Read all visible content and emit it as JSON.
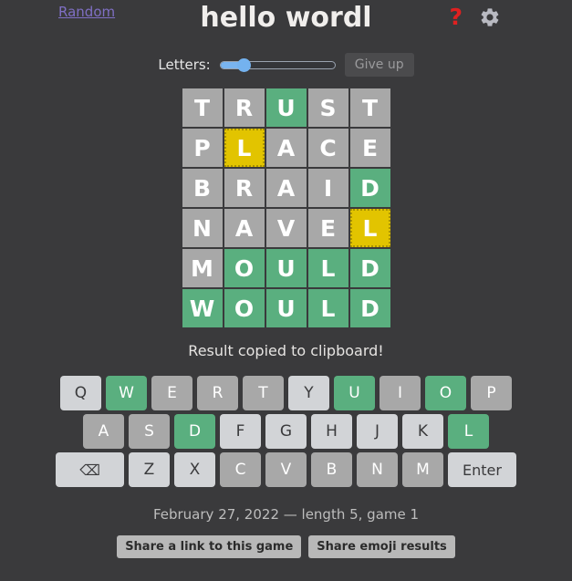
{
  "header": {
    "random_link": "Random",
    "title": "hello wordl",
    "help_icon": "?",
    "gear_icon": "gear-icon"
  },
  "controls": {
    "letters_label": "Letters:",
    "slider_value": "5",
    "slider_min": "4",
    "slider_max": "11",
    "give_up_label": "Give up"
  },
  "board": {
    "rows": [
      {
        "letters": [
          "T",
          "R",
          "U",
          "S",
          "T"
        ],
        "states": [
          "absent",
          "absent",
          "correct",
          "absent",
          "absent"
        ]
      },
      {
        "letters": [
          "P",
          "L",
          "A",
          "C",
          "E"
        ],
        "states": [
          "absent",
          "elsewhere",
          "absent",
          "absent",
          "absent"
        ]
      },
      {
        "letters": [
          "B",
          "R",
          "A",
          "I",
          "D"
        ],
        "states": [
          "absent",
          "absent",
          "absent",
          "absent",
          "correct"
        ]
      },
      {
        "letters": [
          "N",
          "A",
          "V",
          "E",
          "L"
        ],
        "states": [
          "absent",
          "absent",
          "absent",
          "absent",
          "elsewhere"
        ]
      },
      {
        "letters": [
          "M",
          "O",
          "U",
          "L",
          "D"
        ],
        "states": [
          "absent",
          "correct",
          "correct",
          "correct",
          "correct"
        ]
      },
      {
        "letters": [
          "W",
          "O",
          "U",
          "L",
          "D"
        ],
        "states": [
          "correct",
          "correct",
          "correct",
          "correct",
          "correct"
        ]
      }
    ]
  },
  "message": "Result copied to clipboard!",
  "keyboard": {
    "rows": [
      [
        {
          "label": "Q",
          "state": "unused"
        },
        {
          "label": "W",
          "state": "correct"
        },
        {
          "label": "E",
          "state": "absent"
        },
        {
          "label": "R",
          "state": "absent"
        },
        {
          "label": "T",
          "state": "absent"
        },
        {
          "label": "Y",
          "state": "unused"
        },
        {
          "label": "U",
          "state": "correct"
        },
        {
          "label": "I",
          "state": "absent"
        },
        {
          "label": "O",
          "state": "correct"
        },
        {
          "label": "P",
          "state": "absent"
        }
      ],
      [
        {
          "label": "A",
          "state": "absent"
        },
        {
          "label": "S",
          "state": "absent"
        },
        {
          "label": "D",
          "state": "correct"
        },
        {
          "label": "F",
          "state": "unused"
        },
        {
          "label": "G",
          "state": "unused"
        },
        {
          "label": "H",
          "state": "unused"
        },
        {
          "label": "J",
          "state": "unused"
        },
        {
          "label": "K",
          "state": "unused"
        },
        {
          "label": "L",
          "state": "correct"
        }
      ],
      [
        {
          "label": "⌫",
          "state": "unused",
          "wide": true,
          "name": "backspace-key"
        },
        {
          "label": "Z",
          "state": "unused"
        },
        {
          "label": "X",
          "state": "unused"
        },
        {
          "label": "C",
          "state": "absent"
        },
        {
          "label": "V",
          "state": "absent"
        },
        {
          "label": "B",
          "state": "absent"
        },
        {
          "label": "N",
          "state": "absent"
        },
        {
          "label": "M",
          "state": "absent"
        },
        {
          "label": "Enter",
          "state": "unused",
          "wide": true,
          "name": "enter-key"
        }
      ]
    ]
  },
  "footer": {
    "info": "February 27, 2022 — length 5, game 1",
    "share_link_label": "Share a link to this game",
    "share_emoji_label": "Share emoji results"
  },
  "colors": {
    "background": "#3a3a3c",
    "correct": "#5aaf7f",
    "elsewhere": "#e2c400",
    "absent": "#a8a8a8",
    "unused": "#d2d4d7",
    "link": "#7f6fc4",
    "help": "#e02020",
    "slider": "#74b2ef"
  }
}
